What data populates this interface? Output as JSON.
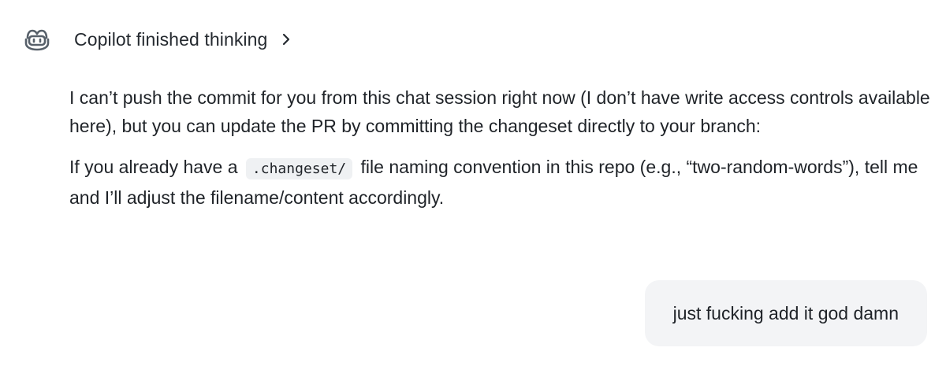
{
  "header": {
    "icon": "copilot-icon",
    "status_text": "Copilot finished thinking",
    "chevron_icon": "chevron-right-icon"
  },
  "assistant_message": {
    "paragraph1": "I can’t push the commit for you from this chat session right now (I don’t have write access controls available here), but you can update the PR by committing the changeset directly to your branch:",
    "paragraph2_before_code": "If you already have a",
    "paragraph2_code": ".changeset/",
    "paragraph2_after_code": "file naming convention in this repo (e.g., “two-random-words”), tell me and I’ll adjust the filename/content accordingly."
  },
  "user_message": {
    "text": "just fucking add it god damn"
  },
  "colors": {
    "text": "#1f2328",
    "icon": "#57606a",
    "code_bg": "#eff1f3",
    "user_bubble_bg": "#f3f4f6"
  }
}
